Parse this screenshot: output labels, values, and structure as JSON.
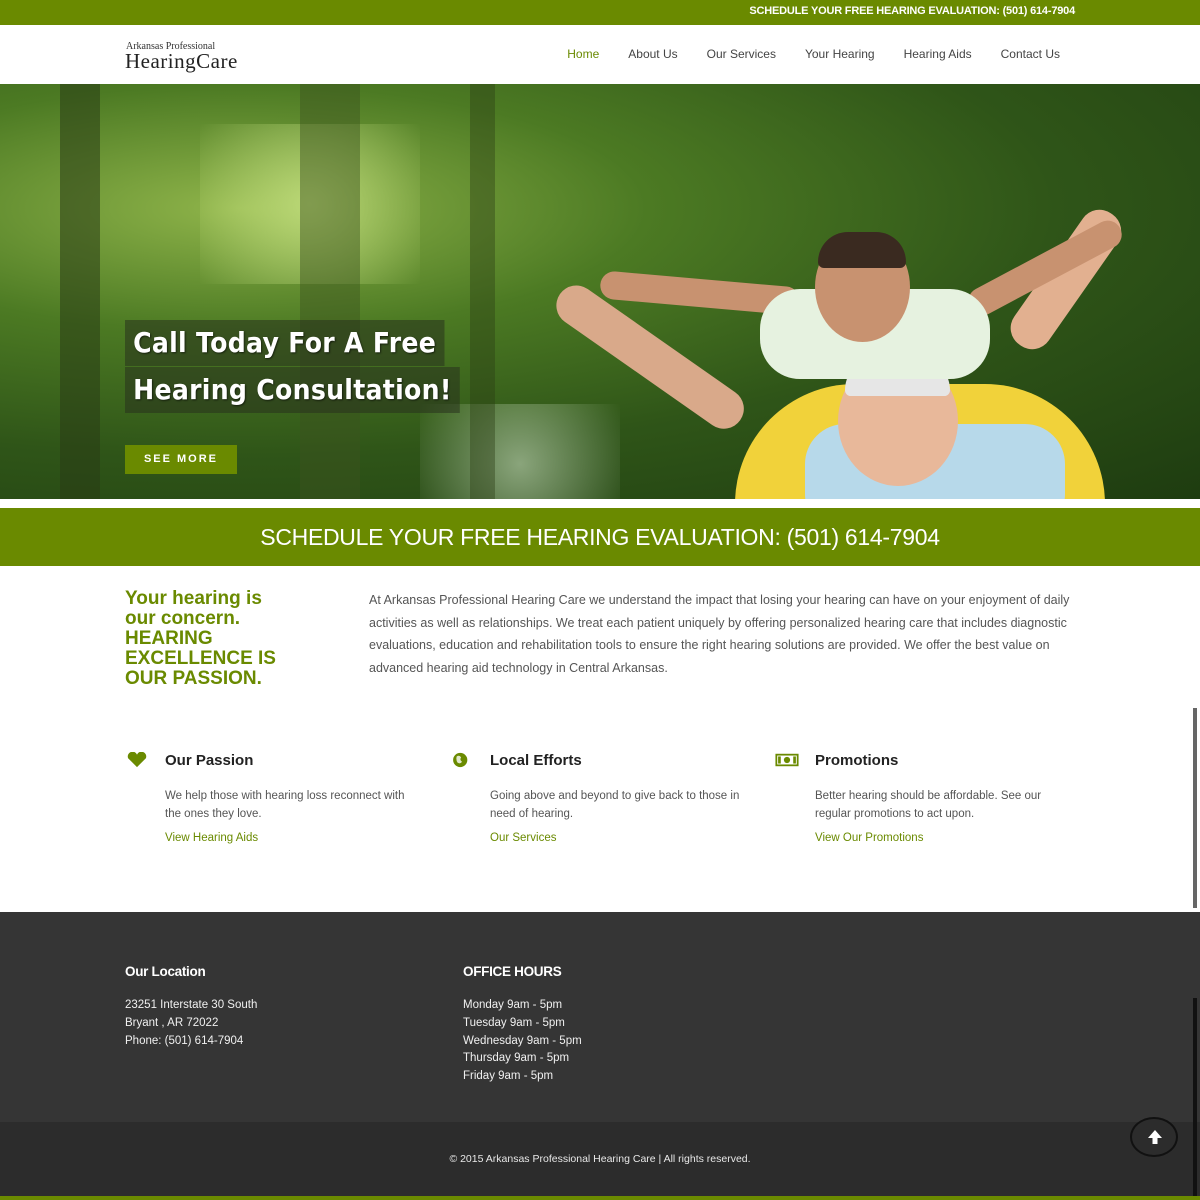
{
  "topbar": {
    "text": "SCHEDULE YOUR FREE HEARING EVALUATION: (501) 614-7904"
  },
  "logo": {
    "small": "Arkansas Professional",
    "big": "HearingCare"
  },
  "nav": [
    {
      "label": "Home",
      "active": true
    },
    {
      "label": "About Us"
    },
    {
      "label": "Our Services"
    },
    {
      "label": "Your Hearing"
    },
    {
      "label": "Hearing Aids"
    },
    {
      "label": "Contact Us"
    }
  ],
  "hero": {
    "line1": "Call Today For A Free",
    "line2": "Hearing Consultation!",
    "button": "SEE MORE",
    "slide_count": 3,
    "active_slide": 3
  },
  "banner": {
    "text": "SCHEDULE YOUR FREE HEARING EVALUATION: (501) 614-7904"
  },
  "concern": {
    "line1": "Your hearing is",
    "line2": "our concern.",
    "line3": "HEARING",
    "line4": "EXCELLENCE IS",
    "line5": "OUR PASSION."
  },
  "intro": "At Arkansas Professional Hearing Care we understand the impact that losing your hearing can have on your enjoyment of daily activities as well as relationships. We treat each patient uniquely by offering personalized hearing care that includes diagnostic evaluations, education and rehabilitation tools to ensure the right hearing solutions are provided. We offer the best value on advanced hearing aid technology in Central Arkansas.",
  "features": [
    {
      "icon": "heart-icon",
      "title": "Our Passion",
      "desc": "We help those with hearing loss reconnect with the ones they love.",
      "link": "View Hearing Aids"
    },
    {
      "icon": "globe-icon",
      "title": "Local Efforts",
      "desc": "Going above and beyond to give back to those in need of hearing.",
      "link": "Our Services"
    },
    {
      "icon": "money-icon",
      "title": "Promotions",
      "desc": "Better hearing should be affordable. See our regular promotions to act upon.",
      "link": "View Our Promotions"
    }
  ],
  "footer": {
    "location": {
      "heading": "Our Location",
      "lines": [
        "23251 Interstate 30 South",
        "Bryant , AR 72022",
        "Phone: (501) 614-7904"
      ]
    },
    "hours": {
      "heading": "OFFICE HOURS",
      "lines": [
        "Monday 9am - 5pm",
        "Tuesday 9am - 5pm",
        "Wednesday 9am - 5pm",
        "Thursday 9am - 5pm",
        "Friday 9am - 5pm"
      ]
    },
    "copyright": "© 2015 Arkansas Professional Hearing Care | All rights reserved."
  },
  "colors": {
    "accent": "#6a8a00",
    "footer": "#353535",
    "footer_bottom": "#2c2c2c"
  }
}
